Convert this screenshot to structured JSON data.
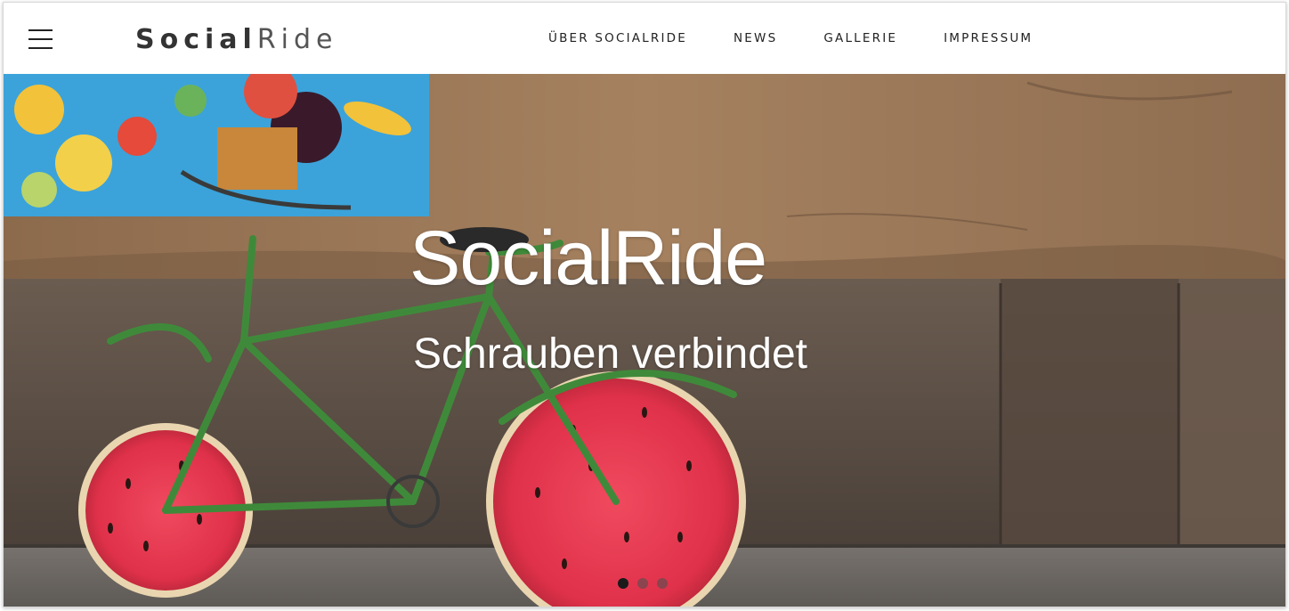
{
  "header": {
    "logo_bold": "Social",
    "logo_light": "Ride",
    "nav": [
      {
        "label": "ÜBER SOCIALRIDE"
      },
      {
        "label": "NEWS"
      },
      {
        "label": "GALLERIE"
      },
      {
        "label": "IMPRESSUM"
      }
    ]
  },
  "hero": {
    "title": "SocialRide",
    "subtitle": "Schrauben verbindet",
    "image_icon": "bicycle-watermelon-wheels-photo",
    "slider": {
      "slide_count": 3,
      "active_index": 0
    }
  },
  "colors": {
    "wall": "#9a7556",
    "stone": "#5c5048",
    "bike_frame": "#3f8a3a",
    "watermelon": "#e33a4f",
    "painting_bg": "#3aa1d8"
  }
}
